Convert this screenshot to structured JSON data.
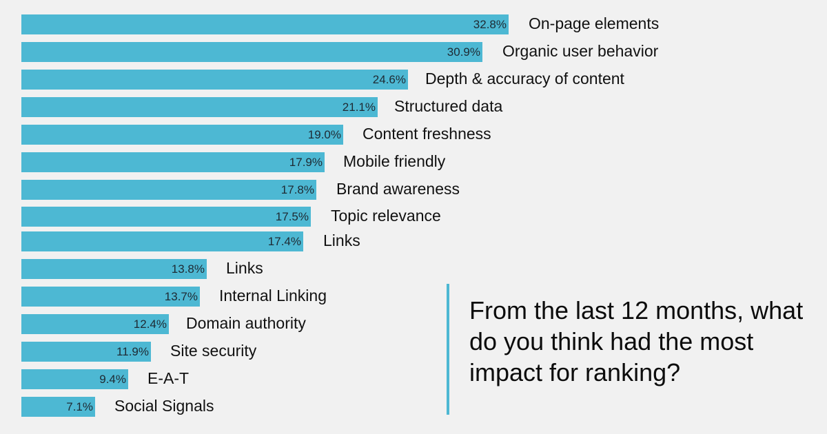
{
  "chart_data": {
    "type": "bar",
    "orientation": "horizontal",
    "title": "From the last 12 months, what do you think had the most impact for ranking?",
    "xlabel": "",
    "ylabel": "",
    "grid": false,
    "value_unit": "%",
    "categories": [
      "On-page elements",
      "Organic user behavior",
      "Depth & accuracy of content",
      "Structured data",
      "Content freshness",
      "Mobile friendly",
      "Brand awareness",
      "Topic relevance",
      "Links",
      "Links",
      "Internal Linking",
      "Domain authority",
      "Site security",
      "E-A-T",
      "Social Signals"
    ],
    "values": [
      32.8,
      30.9,
      24.6,
      21.1,
      19.0,
      17.9,
      17.8,
      17.5,
      17.4,
      13.8,
      13.7,
      12.4,
      11.9,
      9.4,
      7.1
    ],
    "data_labels": [
      "32.8%",
      "30.9%",
      "24.6%",
      "21.1%",
      "19.0%",
      "17.9%",
      "17.8%",
      "17.5%",
      "17.4%",
      "13.8%",
      "13.7%",
      "12.4%",
      "11.9%",
      "9.4%",
      "7.1%"
    ],
    "bar_color": "#4db8d3"
  },
  "question": "From the last 12 months, what do you think had the most impact for ranking?",
  "colors": {
    "accent": "#4db8d3",
    "background": "#f1f1f1"
  }
}
